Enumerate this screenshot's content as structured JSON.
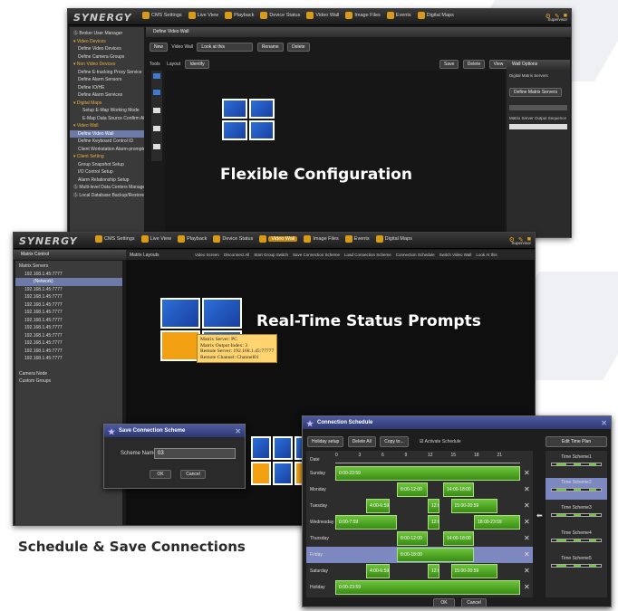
{
  "window1": {
    "logo": "SYNERGY",
    "menu": [
      "CMS Settings",
      "Live View",
      "Playback",
      "Device Status",
      "Video Wall",
      "Image Files",
      "Events",
      "Digital Maps"
    ],
    "user": "Supervisor",
    "sidebar": [
      {
        "label": "Ⓢ Broker User Manager",
        "type": "item"
      },
      {
        "label": "▾ Video Devices",
        "type": "sec"
      },
      {
        "label": "Define Video Devices",
        "type": "sub"
      },
      {
        "label": "Define Camera Groups",
        "type": "sub"
      },
      {
        "label": "▾ Non Video Devices",
        "type": "sec"
      },
      {
        "label": "Define E-tracking Proxy Service",
        "type": "sub"
      },
      {
        "label": "Define Alarm Sensors",
        "type": "sub"
      },
      {
        "label": "Define IO/HE",
        "type": "sub"
      },
      {
        "label": "Define Alarm Services",
        "type": "sub"
      },
      {
        "label": "▾ Digital Maps",
        "type": "sec"
      },
      {
        "label": "Setup E-Map Working Mode",
        "type": "sub2"
      },
      {
        "label": "E-Map Data Source Confirm Alias",
        "type": "sub2"
      },
      {
        "label": "▾ Video Wall",
        "type": "sec"
      },
      {
        "label": "Define Video Wall",
        "type": "selected"
      },
      {
        "label": "Define Keyboard Control ID",
        "type": "sub"
      },
      {
        "label": "Client Workstation Alarm-prompted Synchronize Display Settings",
        "type": "sub"
      },
      {
        "label": "▾ Client Setting",
        "type": "sec"
      },
      {
        "label": "Group Snapshot Setup",
        "type": "sub"
      },
      {
        "label": "I/O Control Setup",
        "type": "sub"
      },
      {
        "label": "Alarm Relationship Setup",
        "type": "sub"
      },
      {
        "label": "Ⓢ Multi-level Data Centers Manager",
        "type": "item"
      },
      {
        "label": "Ⓢ Local Database Backup/Restore",
        "type": "item"
      }
    ],
    "header": "Define Video Wall",
    "toolbar": {
      "new": "New",
      "video_wall_label": "Video Wall",
      "combo": "Look at this",
      "rename": "Rename",
      "delete": "Delete"
    },
    "tabs": {
      "tools": "Tools",
      "layout": "Layout",
      "identify": "Identify"
    },
    "buttons_right": [
      "Save",
      "Delete",
      "View"
    ],
    "options": {
      "title": "Wall Options",
      "label1": "Digital Matrix Servers",
      "btn": "Define Matrix Servers",
      "label2": "Matrix Server Output Sequence No."
    },
    "feature": "Flexible Configuration"
  },
  "window2": {
    "logo": "SYNERGY",
    "menu": [
      "CMS Settings",
      "Live View",
      "Playback",
      "Device Status",
      "Video Wall",
      "Image Files",
      "Events",
      "Digital Maps"
    ],
    "user": "Supervisor",
    "header_left": "Matrix Control",
    "header_right": "Matrix Layouts",
    "toolbar": [
      "Video Screen",
      "Disconnect All",
      "Start Group Switch",
      "Save Connection Scheme",
      "Load Connection Scheme",
      "Connection Schedule",
      "Switch Video Wall",
      "Look At this"
    ],
    "tree": [
      "Matrix Servers",
      "192.168.1.45:7777",
      "(Network)",
      "192.168.1.45:7777",
      "192.168.1.45:7777",
      "192.168.1.45:7777",
      "192.168.1.45:7777",
      "192.168.1.45:7777",
      "192.168.1.45:7777",
      "192.168.1.45:7777",
      "192.168.1.45:7777",
      "192.168.1.45:7777",
      "192.168.1.45:7777",
      "Camera Node",
      "Custom Groups"
    ],
    "feature": "Real-Time Status Prompts",
    "tooltip": [
      "Matrix Server: PC",
      "Matrix Output Index: 3",
      "Remote Server: 192.168.1.45:77777",
      "Remote Channel: Channel01"
    ]
  },
  "save_dialog": {
    "title": "Save Connection Scheme",
    "label": "Scheme Name",
    "value": "03",
    "ok": "OK",
    "cancel": "Cancel"
  },
  "schedule": {
    "title": "Connection Schedule",
    "buttons": {
      "holiday": "Holiday setup",
      "delete_all": "Delete All",
      "copy": "Copy to...",
      "activate": "Activate Schedule",
      "edit": "Edit Time Plan",
      "ok": "OK",
      "cancel": "Cancel"
    },
    "date_label": "Date",
    "hours": [
      "0",
      "3",
      "6",
      "9",
      "12",
      "15",
      "18",
      "21"
    ],
    "rows": [
      {
        "day": "Sunday",
        "blocks": [
          {
            "text": "0:00-23:59",
            "start": 0,
            "end": 24
          }
        ]
      },
      {
        "day": "Monday",
        "blocks": [
          {
            "text": "8:00-12:00",
            "start": 8,
            "end": 12
          },
          {
            "text": "14:00-18:00",
            "start": 14,
            "end": 18
          }
        ]
      },
      {
        "day": "Tuesday",
        "blocks": [
          {
            "text": "4:00-6:59",
            "start": 4,
            "end": 7
          },
          {
            "text": "12:0...",
            "start": 12,
            "end": 13.5
          },
          {
            "text": "15:00-20:59",
            "start": 15,
            "end": 21
          }
        ]
      },
      {
        "day": "Wednesday",
        "blocks": [
          {
            "text": "0:00-7:59",
            "start": 0,
            "end": 8
          },
          {
            "text": "12:0...",
            "start": 12,
            "end": 13.5
          },
          {
            "text": "18:00-23:59",
            "start": 18,
            "end": 24
          }
        ]
      },
      {
        "day": "Thursday",
        "blocks": [
          {
            "text": "8:00-12:00",
            "start": 8,
            "end": 12
          },
          {
            "text": "14:00-18:00",
            "start": 14,
            "end": 18
          }
        ]
      },
      {
        "day": "Friday",
        "blocks": [
          {
            "text": "8:00-18:00",
            "start": 8,
            "end": 18
          }
        ],
        "selected": true
      },
      {
        "day": "Saturday",
        "blocks": [
          {
            "text": "4:00-6:59",
            "start": 4,
            "end": 7
          },
          {
            "text": "12:0...",
            "start": 12,
            "end": 13.5
          },
          {
            "text": "15:00-20:59",
            "start": 15,
            "end": 21
          }
        ]
      },
      {
        "day": "Holiday",
        "blocks": [
          {
            "text": "0:00-23:59",
            "start": 0,
            "end": 24
          }
        ]
      }
    ],
    "schemes": [
      "Time Scheme1",
      "Time Scheme2",
      "Time Scheme3",
      "Time Scheme4",
      "Time Scheme5"
    ],
    "selected_scheme": 1
  },
  "feature3": "Schedule & Save Connections",
  "colors": {
    "accent": "#d99a18",
    "bar": "#6dc43a",
    "selected": "#6d7aa8",
    "feature_text": "#ffffff",
    "feature3_text": "#2a2a2a"
  }
}
